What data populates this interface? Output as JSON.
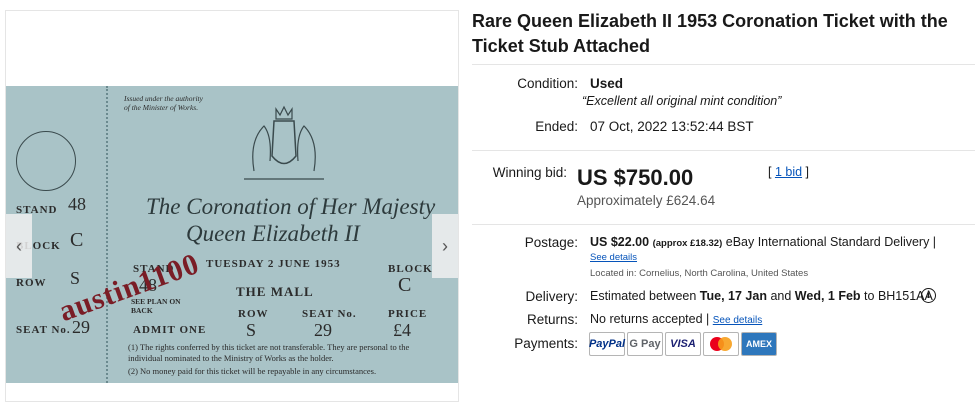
{
  "item": {
    "title": "Rare Queen Elizabeth II 1953 Coronation Ticket with the Ticket Stub Attached"
  },
  "gallery": {
    "prev_icon": "chevron-left-icon",
    "next_icon": "chevron-right-icon",
    "ticket": {
      "issued_note": "Issued under the authority of the Minister of Works.",
      "stub_stand_label": "STAND",
      "stub_stand": "48",
      "stub_block_label": "BLOCK",
      "stub_block": "C",
      "stub_row_label": "ROW",
      "stub_row": "S",
      "stub_seat_label": "SEAT No.",
      "stub_seat": "29",
      "heading1": "The Coronation of Her Majesty",
      "heading2": "Queen Elizabeth II",
      "date": "TUESDAY 2 JUNE 1953",
      "stand_label": "STAND",
      "stand": "48",
      "see_plan": "SEE PLAN ON BACK",
      "location": "THE MALL",
      "block_label": "BLOCK",
      "block": "C",
      "admit": "ADMIT ONE",
      "row_label": "ROW",
      "row": "S",
      "seat_label": "SEAT No.",
      "seat": "29",
      "price_label": "PRICE",
      "price": "£4",
      "rule1": "(1) The rights conferred by this ticket are not transferable. They are personal to the individual nominated to the Ministry of Works as the holder.",
      "rule2": "(2) No money paid for this ticket will be repayable in any circumstances.",
      "watermark": "austin1100"
    }
  },
  "details": {
    "condition_label": "Condition:",
    "condition": "Used",
    "condition_quote": "Excellent all original mint condition",
    "ended_label": "Ended:",
    "ended": "07 Oct, 2022 13:52:44 BST",
    "winning_label": "Winning bid:",
    "winning_bid": "US $750.00",
    "approx": "Approximately £624.64",
    "bids_link": "1 bid",
    "postage_label": "Postage:",
    "postage_price": "US $22.00",
    "postage_approx": "(approx £18.32)",
    "postage_service": "eBay International Standard Delivery |",
    "see_details": "See details",
    "located": "Located in: Cornelius, North Carolina, United States",
    "delivery_label": "Delivery:",
    "delivery_prefix": "Estimated between",
    "delivery_start": "Tue, 17 Jan",
    "delivery_and": "and",
    "delivery_end": "Wed, 1 Feb",
    "delivery_to": "to BH151AA",
    "returns_label": "Returns:",
    "returns": "No returns accepted |",
    "returns_link": "See details",
    "payments_label": "Payments:",
    "payments": [
      "PayPal",
      "G Pay",
      "VISA",
      "Mastercard",
      "AMEX"
    ],
    "colors": {
      "link": "#0654ba",
      "paypal": "#003087",
      "visa": "#1a1f71",
      "amex": "#2e77bc",
      "mc_red": "#eb001b",
      "mc_orange": "#f79e1b"
    }
  }
}
